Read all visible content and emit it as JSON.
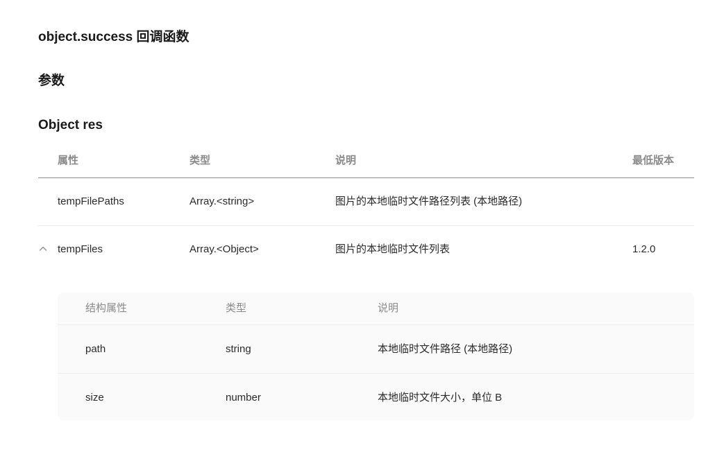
{
  "headings": {
    "callback": "object.success 回调函数",
    "params": "参数",
    "object_res": "Object res"
  },
  "params_table": {
    "headers": [
      "属性",
      "类型",
      "说明",
      "最低版本"
    ],
    "rows": [
      {
        "name": "tempFilePaths",
        "type": "Array.<string>",
        "desc": "图片的本地临时文件路径列表 (本地路径)",
        "version": ""
      },
      {
        "name": "tempFiles",
        "type": "Array.<Object>",
        "desc": "图片的本地临时文件列表",
        "version": "1.2.0",
        "icon": "chevron-up-icon",
        "expanded": true
      }
    ]
  },
  "sub_table": {
    "headers": [
      "结构属性",
      "类型",
      "说明"
    ],
    "rows": [
      {
        "name": "path",
        "type": "string",
        "desc": "本地临时文件路径 (本地路径)"
      },
      {
        "name": "size",
        "type": "number",
        "desc": "本地临时文件大小，单位 B"
      }
    ]
  },
  "colors": {
    "version_link": "#576b95",
    "header_text": "#8a8a8a",
    "sub_table_bg": "#fafafa"
  }
}
